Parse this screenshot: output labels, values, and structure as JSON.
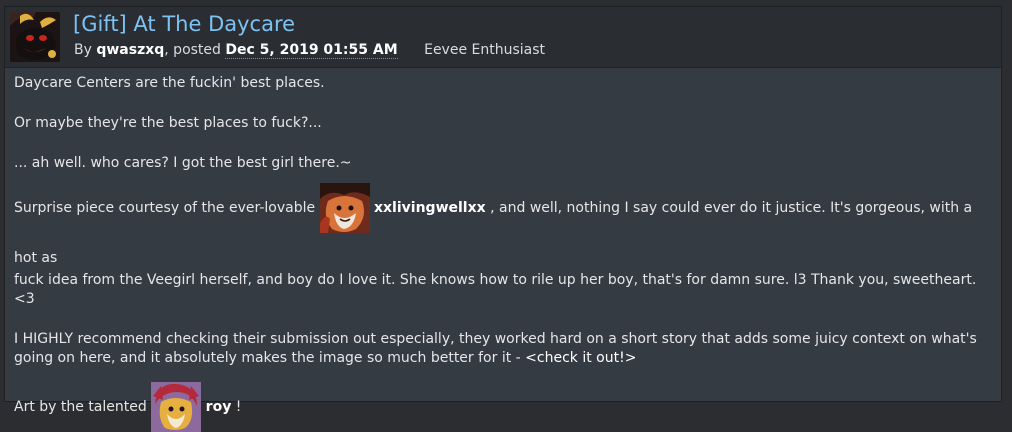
{
  "journal": {
    "title": "[Gift] At The Daycare",
    "by_prefix": "By",
    "author": "qwaszxq",
    "posted_prefix": ", posted",
    "date": "Dec 5, 2019 01:55 AM",
    "author_tagline": "Eevee Enthusiast"
  },
  "body": {
    "p1": "Daycare Centers are the fuckin' best places.",
    "p2": "Or maybe they're the best places to fuck?...",
    "p3": "... ah well. who cares? I got the best girl there.~",
    "p4_before": "Surprise piece courtesy of the ever-lovable",
    "p4_user": "xxlivingwellxx",
    "p4_after": ", and well, nothing I say could ever do it justice. It's gorgeous, with a hot as",
    "p4_line2": "fuck idea from the Veegirl herself, and boy do I love it. She knows how to rile up her boy, that's for damn sure. l3 Thank you, sweetheart. <3",
    "p5_text": "I HIGHLY recommend checking their submission out especially, they worked hard on a short story that adds some juicy context on what's going on here, and it absolutely makes the image so much better for it -",
    "p5_link": "<check it out!>",
    "p6_before": "Art by the talented",
    "p6_user": "roy",
    "p6_after": "!"
  },
  "colors": {
    "title": "#7ec2f2",
    "header_bg": "#2a2e33",
    "panel_bg": "#353b42"
  }
}
